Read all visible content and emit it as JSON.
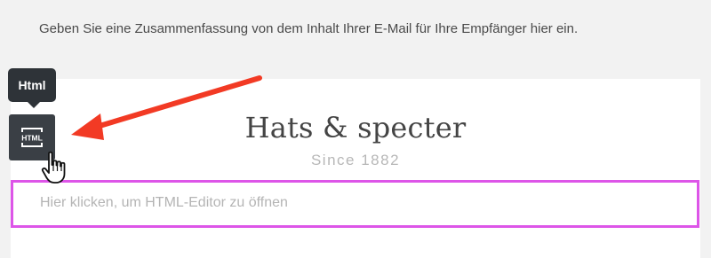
{
  "preheader": {
    "text": "Geben Sie eine Zusammenfassung von dem Inhalt Ihrer E-Mail für Ihre Empfänger hier ein."
  },
  "logo": {
    "title": "Hats & specter",
    "subtitle": "Since 1882"
  },
  "tooltip": {
    "label": "Html"
  },
  "html_tool": {
    "icon_text": "HTML",
    "icon": "html-file-icon"
  },
  "html_block": {
    "placeholder": "Hier klicken, um HTML-Editor zu öffnen"
  },
  "annotation": {
    "arrow_color": "#f23a24"
  },
  "colors": {
    "background": "#f2f2f2",
    "canvas": "#ffffff",
    "selection_border": "#dd55e8",
    "tool_button": "#3a3f45",
    "tooltip": "#2e3338"
  }
}
